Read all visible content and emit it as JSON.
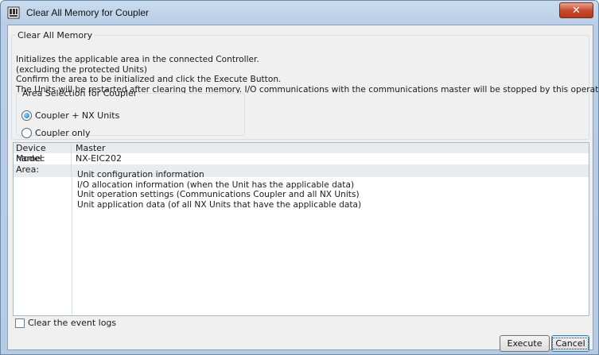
{
  "window": {
    "title": "Clear All Memory for Coupler",
    "close_glyph": "✕"
  },
  "clear_group": {
    "legend": "Clear All Memory",
    "lines": [
      "Initializes the applicable area in the connected Controller.",
      "(excluding the protected Units)",
      "Confirm the area to be initialized and click the Execute Button.",
      "The Units will be restarted after clearing the memory. I/O communications with the communications master will be stopped by this operation."
    ]
  },
  "area_group": {
    "legend": "Area Selection for Coupler",
    "options": [
      {
        "label": "Coupler + NX Units",
        "selected": true
      },
      {
        "label": "Coupler only",
        "selected": false
      }
    ]
  },
  "info": {
    "device_name_label": "Device name:",
    "device_name_value": "Master",
    "model_label": "Model:",
    "model_value": "NX-EIC202",
    "area_label": "Area:",
    "area_values": [
      "Unit configuration information",
      "I/O allocation information (when the Unit has the applicable data)",
      "Unit operation settings (Communications Coupler and all NX Units)",
      "Unit application data (of all NX Units that have the applicable data)"
    ]
  },
  "event_logs": {
    "label": "Clear the event logs",
    "checked": false
  },
  "buttons": {
    "execute": "Execute",
    "cancel": "Cancel"
  },
  "colors": {
    "title_bar": "#c9dbee",
    "close_button": "#c84b2f",
    "radio_selected": "#1b6fb8"
  }
}
